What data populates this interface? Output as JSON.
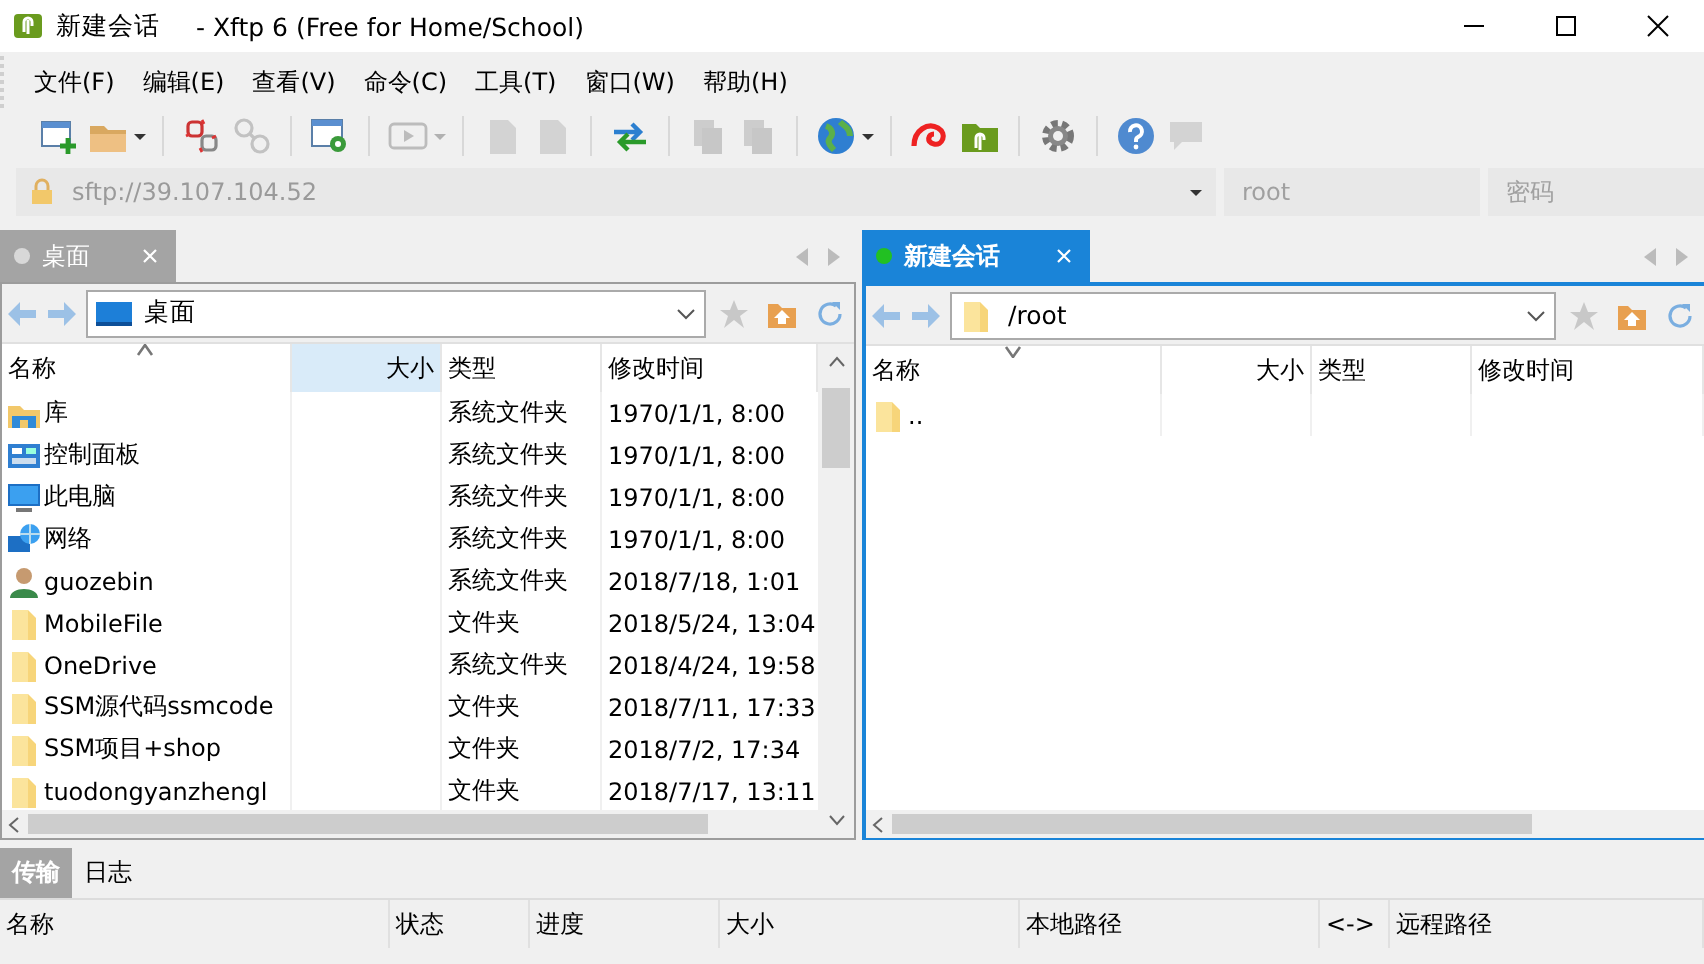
{
  "window": {
    "title": "新建会话",
    "app_title": "- Xftp 6 (Free for Home/School)"
  },
  "menu": [
    "文件(F)",
    "编辑(E)",
    "查看(V)",
    "命令(C)",
    "工具(T)",
    "窗口(W)",
    "帮助(H)"
  ],
  "toolbar": [
    {
      "kind": "new-window",
      "disabled": false,
      "dropdown": false
    },
    {
      "kind": "folder",
      "disabled": false,
      "dropdown": true
    },
    {
      "kind": "separator"
    },
    {
      "kind": "broken-link",
      "disabled": false,
      "dropdown": false
    },
    {
      "kind": "link",
      "disabled": true,
      "dropdown": false
    },
    {
      "kind": "separator"
    },
    {
      "kind": "window-gear",
      "disabled": false,
      "dropdown": false
    },
    {
      "kind": "separator"
    },
    {
      "kind": "play",
      "disabled": true,
      "dropdown": true
    },
    {
      "kind": "separator"
    },
    {
      "kind": "document",
      "disabled": true,
      "dropdown": false
    },
    {
      "kind": "document",
      "disabled": true,
      "dropdown": false
    },
    {
      "kind": "separator"
    },
    {
      "kind": "swap",
      "disabled": false,
      "dropdown": false
    },
    {
      "kind": "separator"
    },
    {
      "kind": "copy",
      "disabled": true,
      "dropdown": false
    },
    {
      "kind": "copy",
      "disabled": true,
      "dropdown": false
    },
    {
      "kind": "separator"
    },
    {
      "kind": "globe",
      "disabled": false,
      "dropdown": true
    },
    {
      "kind": "separator"
    },
    {
      "kind": "swirl",
      "disabled": false,
      "dropdown": false
    },
    {
      "kind": "app",
      "disabled": false,
      "dropdown": false
    },
    {
      "kind": "separator"
    },
    {
      "kind": "gear",
      "disabled": false,
      "dropdown": false
    },
    {
      "kind": "separator"
    },
    {
      "kind": "help",
      "disabled": false,
      "dropdown": false
    },
    {
      "kind": "chat",
      "disabled": true,
      "dropdown": false
    }
  ],
  "address_bar": {
    "placeholder": "sftp://39.107.104.52",
    "user_placeholder": "root",
    "password_placeholder": "密码"
  },
  "panes": [
    {
      "active": false,
      "tab": {
        "label": "桌面",
        "connected": false,
        "selected": true
      },
      "path": {
        "value": "桌面",
        "kind": "desktop"
      },
      "columns": [
        {
          "label": "名称",
          "sorted": true,
          "descending": false,
          "highlighted": false
        },
        {
          "label": "大小",
          "sorted": false,
          "highlighted": true
        },
        {
          "label": "类型",
          "sorted": false,
          "highlighted": false
        },
        {
          "label": "修改时间",
          "sorted": false,
          "highlighted": false
        }
      ],
      "rows": [
        {
          "kind": "library",
          "name": "库",
          "type": "系统文件夹",
          "modified": "1970/1/1, 8:00"
        },
        {
          "kind": "control-panel",
          "name": "控制面板",
          "type": "系统文件夹",
          "modified": "1970/1/1, 8:00"
        },
        {
          "kind": "computer",
          "name": "此电脑",
          "type": "系统文件夹",
          "modified": "1970/1/1, 8:00"
        },
        {
          "kind": "network",
          "name": "网络",
          "type": "系统文件夹",
          "modified": "1970/1/1, 8:00"
        },
        {
          "kind": "user",
          "name": "guozebin",
          "type": "系统文件夹",
          "modified": "2018/7/18, 1:01"
        },
        {
          "kind": "folder",
          "name": "MobileFile",
          "type": "文件夹",
          "modified": "2018/5/24, 13:04"
        },
        {
          "kind": "folder",
          "name": "OneDrive",
          "type": "系统文件夹",
          "modified": "2018/4/24, 19:58"
        },
        {
          "kind": "folder",
          "name": "SSM源代码ssmcode",
          "type": "文件夹",
          "modified": "2018/7/11, 17:33"
        },
        {
          "kind": "folder",
          "name": "SSM项目+shop",
          "type": "文件夹",
          "modified": "2018/7/2, 17:34"
        },
        {
          "kind": "folder",
          "name": "tuodongyanzhengl",
          "type": "文件夹",
          "modified": "2018/7/17, 13:11"
        }
      ]
    },
    {
      "active": true,
      "tab": {
        "label": "新建会话",
        "connected": true,
        "selected": true
      },
      "path": {
        "value": "/root",
        "kind": "folder"
      },
      "columns": [
        {
          "label": "名称",
          "sorted": true,
          "descending": true,
          "highlighted": false
        },
        {
          "label": "大小",
          "sorted": false,
          "highlighted": false
        },
        {
          "label": "类型",
          "sorted": false,
          "highlighted": false
        },
        {
          "label": "修改时间",
          "sorted": false,
          "highlighted": false
        }
      ],
      "rows": [
        {
          "kind": "folder",
          "name": ".."
        }
      ]
    }
  ],
  "transfer": {
    "tabs": [
      {
        "label": "传输",
        "selected": true
      },
      {
        "label": "日志",
        "selected": false
      }
    ],
    "columns": [
      "名称",
      "状态",
      "进度",
      "大小",
      "本地路径",
      "<->",
      "远程路径"
    ]
  }
}
